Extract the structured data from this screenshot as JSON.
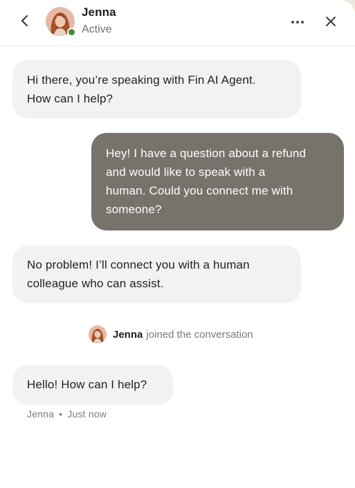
{
  "header": {
    "agent_name": "Jenna",
    "agent_status": "Active",
    "back_icon": "chevron-left-icon",
    "more_icon": "ellipsis-icon",
    "close_icon": "close-icon",
    "status_color": "#3f8a3d"
  },
  "messages": [
    {
      "sender": "bot",
      "text_lines": [
        "Hi there, you’re speaking with Fin AI Agent.",
        "How can I help?"
      ]
    },
    {
      "sender": "user",
      "text_lines": [
        "Hey! I have a question about a refund",
        "and would like to speak with a",
        "human. Could you connect me with",
        "someone?"
      ]
    },
    {
      "sender": "bot",
      "text_lines": [
        "No problem! I’ll connect you with a human",
        "colleague who can assist."
      ]
    }
  ],
  "system_event": {
    "name": "Jenna",
    "text": "joined the conversation"
  },
  "last_message": {
    "text": "Hello! How can I help?",
    "author": "Jenna",
    "separator": "•",
    "time": "Just now"
  },
  "colors": {
    "incoming_bubble": "#f3f2f1",
    "outgoing_bubble": "#77736c",
    "background": "#ece7df"
  }
}
